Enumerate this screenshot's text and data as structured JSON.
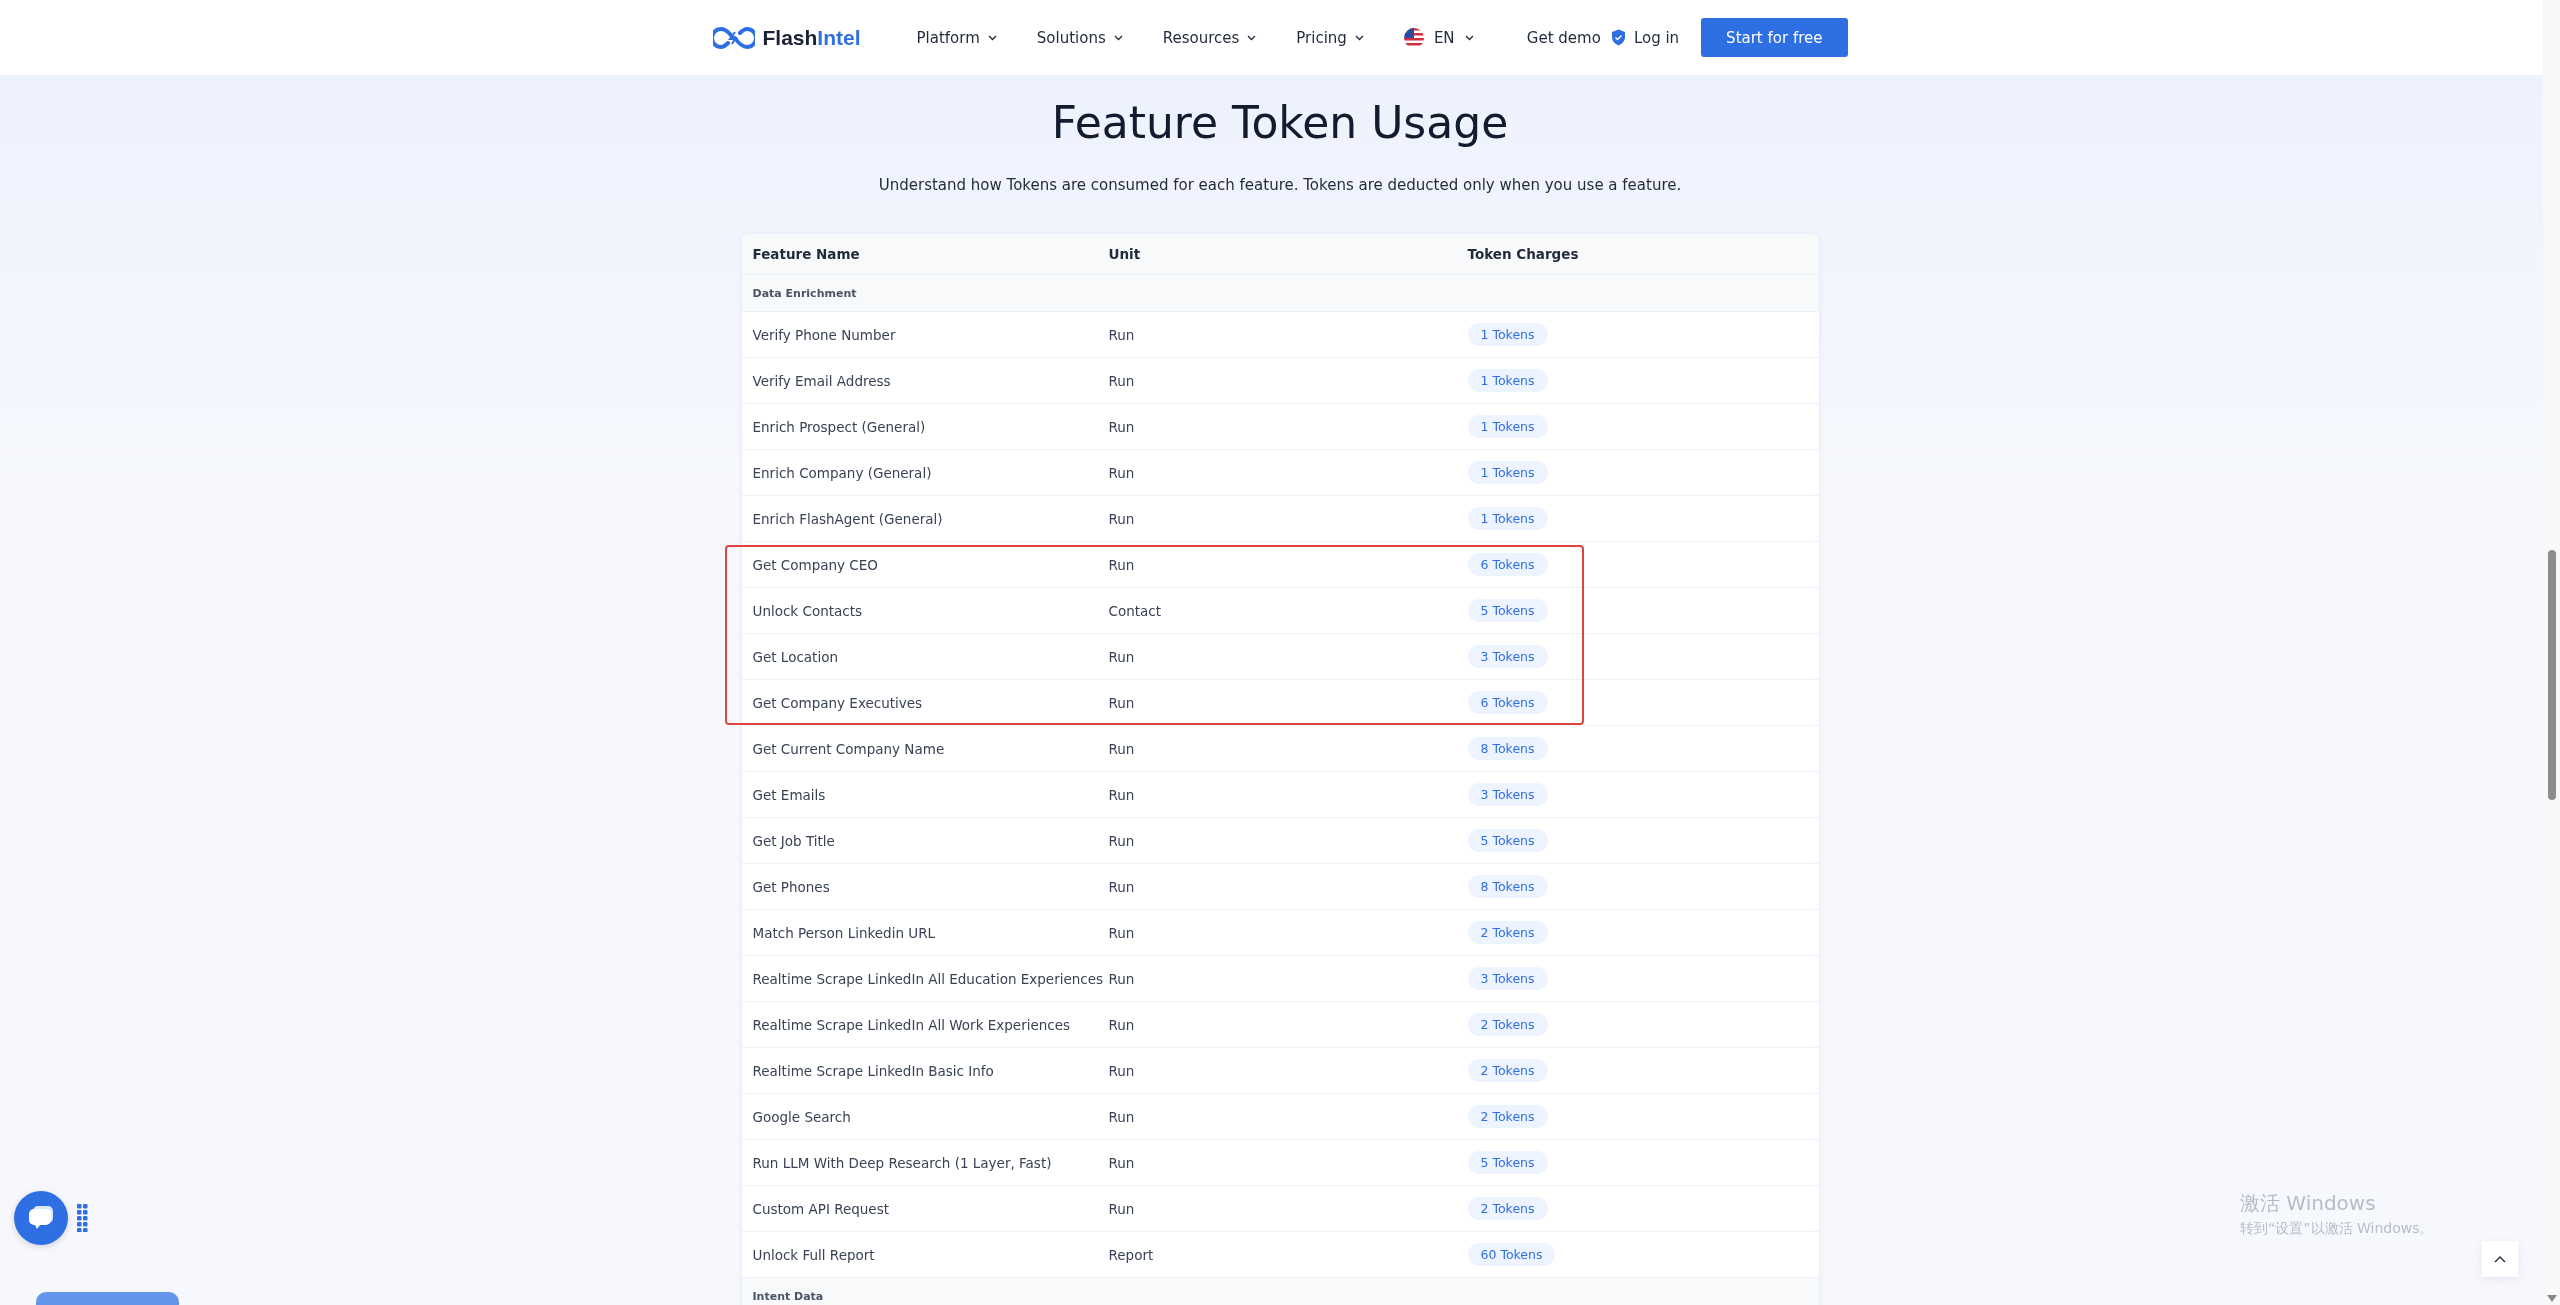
{
  "nav": {
    "logo": {
      "dark": "Flash",
      "accent": "Intel"
    },
    "menu": [
      {
        "label": "Platform",
        "dropdown": true
      },
      {
        "label": "Solutions",
        "dropdown": true
      },
      {
        "label": "Resources",
        "dropdown": true
      },
      {
        "label": "Pricing",
        "dropdown": true
      }
    ],
    "language": {
      "label": "EN",
      "dropdown": true
    },
    "demo_link": "Get demo",
    "login_link": "Log in",
    "cta_button": "Start for free"
  },
  "heading": "Feature Token Usage",
  "subheading": "Understand how Tokens are consumed for each feature. Tokens are deducted only when you use a feature.",
  "table": {
    "columns": [
      "Feature Name",
      "Unit",
      "Token Charges"
    ],
    "rows": [
      {
        "kind": "section",
        "label": "Data Enrichment"
      },
      {
        "kind": "feature",
        "name": "Verify Phone Number",
        "unit": "Run",
        "charge": "1 Tokens"
      },
      {
        "kind": "feature",
        "name": "Verify Email Address",
        "unit": "Run",
        "charge": "1 Tokens"
      },
      {
        "kind": "feature",
        "name": "Enrich Prospect (General)",
        "unit": "Run",
        "charge": "1 Tokens"
      },
      {
        "kind": "feature",
        "name": "Enrich Company (General)",
        "unit": "Run",
        "charge": "1 Tokens"
      },
      {
        "kind": "feature",
        "name": "Enrich FlashAgent (General)",
        "unit": "Run",
        "charge": "1 Tokens"
      },
      {
        "kind": "highlight_group",
        "rows": [
          {
            "kind": "feature",
            "name": "Get Company CEO",
            "unit": "Run",
            "charge": "6 Tokens"
          },
          {
            "kind": "feature",
            "name": "Unlock Contacts",
            "unit": "Contact",
            "charge": "5 Tokens"
          },
          {
            "kind": "feature",
            "name": "Get Location",
            "unit": "Run",
            "charge": "3 Tokens"
          },
          {
            "kind": "feature",
            "name": "Get Company Executives",
            "unit": "Run",
            "charge": "6 Tokens"
          }
        ]
      },
      {
        "kind": "feature",
        "name": "Get Current Company Name",
        "unit": "Run",
        "charge": "8 Tokens"
      },
      {
        "kind": "feature",
        "name": "Get Emails",
        "unit": "Run",
        "charge": "3 Tokens"
      },
      {
        "kind": "feature",
        "name": "Get Job Title",
        "unit": "Run",
        "charge": "5 Tokens"
      },
      {
        "kind": "feature",
        "name": "Get Phones",
        "unit": "Run",
        "charge": "8 Tokens"
      },
      {
        "kind": "feature",
        "name": "Match Person Linkedin URL",
        "unit": "Run",
        "charge": "2 Tokens"
      },
      {
        "kind": "feature",
        "name": "Realtime Scrape LinkedIn All Education Experiences",
        "unit": "Run",
        "charge": "3 Tokens"
      },
      {
        "kind": "feature",
        "name": "Realtime Scrape LinkedIn All Work Experiences",
        "unit": "Run",
        "charge": "2 Tokens"
      },
      {
        "kind": "feature",
        "name": "Realtime Scrape LinkedIn Basic Info",
        "unit": "Run",
        "charge": "2 Tokens"
      },
      {
        "kind": "feature",
        "name": "Google Search",
        "unit": "Run",
        "charge": "2 Tokens"
      },
      {
        "kind": "feature",
        "name": "Run LLM With Deep Research (1 Layer, Fast)",
        "unit": "Run",
        "charge": "5 Tokens"
      },
      {
        "kind": "feature",
        "name": "Custom API Request",
        "unit": "Run",
        "charge": "2 Tokens"
      },
      {
        "kind": "feature",
        "name": "Unlock Full Report",
        "unit": "Report",
        "charge": "60 Tokens"
      },
      {
        "kind": "section",
        "label": "Intent Data"
      }
    ]
  },
  "os_notice": {
    "title": "激活 Windows",
    "message": "转到“设置”以激活 Windows。"
  }
}
